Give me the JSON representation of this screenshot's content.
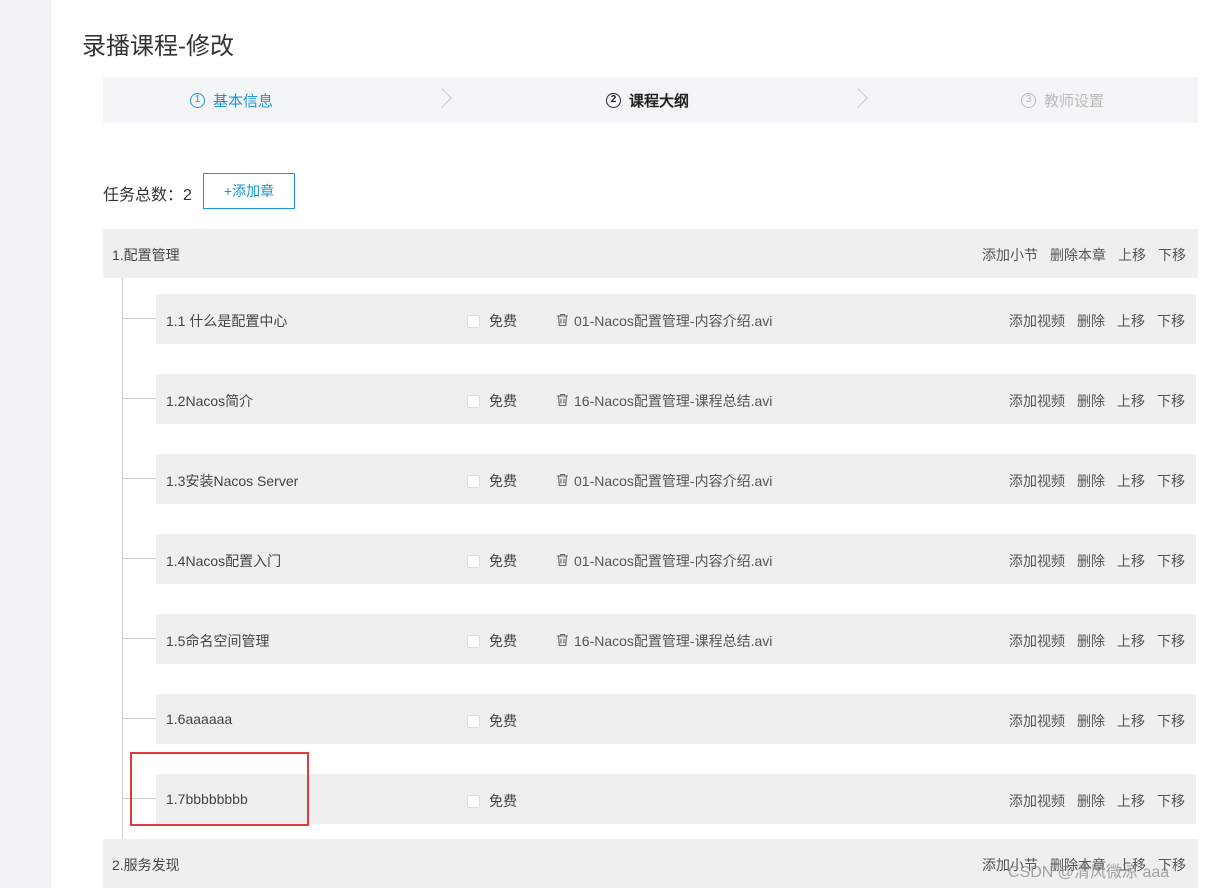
{
  "page": {
    "title": "录播课程-修改"
  },
  "steps": [
    {
      "num": "1",
      "label": "基本信息",
      "state": "done"
    },
    {
      "num": "2",
      "label": "课程大纲",
      "state": "active"
    },
    {
      "num": "3",
      "label": "教师设置",
      "state": "todo"
    }
  ],
  "toolbar": {
    "task_count": "任务总数：2",
    "add_chapter": "+添加章"
  },
  "chapter_actions": {
    "add_section": "添加小节",
    "delete_chapter": "删除本章",
    "move_up": "上移",
    "move_down": "下移"
  },
  "section_actions": {
    "add_video": "添加视频",
    "delete": "删除",
    "move_up": "上移",
    "move_down": "下移",
    "free": "免费"
  },
  "chapters": [
    {
      "title": "1.配置管理",
      "sections": [
        {
          "title": "1.1 什么是配置中心",
          "video": "01-Nacos配置管理-内容介绍.avi"
        },
        {
          "title": "1.2Nacos简介",
          "video": "16-Nacos配置管理-课程总结.avi"
        },
        {
          "title": "1.3安装Nacos Server",
          "video": "01-Nacos配置管理-内容介绍.avi"
        },
        {
          "title": "1.4Nacos配置入门",
          "video": "01-Nacos配置管理-内容介绍.avi"
        },
        {
          "title": "1.5命名空间管理",
          "video": "16-Nacos配置管理-课程总结.avi"
        },
        {
          "title": "1.6aaaaaa",
          "video": ""
        },
        {
          "title": "1.7bbbbbbbb",
          "video": ""
        }
      ]
    },
    {
      "title": "2.服务发现",
      "sections": []
    }
  ],
  "watermark": "CSDN @清风微凉 aaa",
  "colors": {
    "accent": "#1a95d6",
    "highlight": "#e0393e",
    "row_bg": "#efefef"
  }
}
